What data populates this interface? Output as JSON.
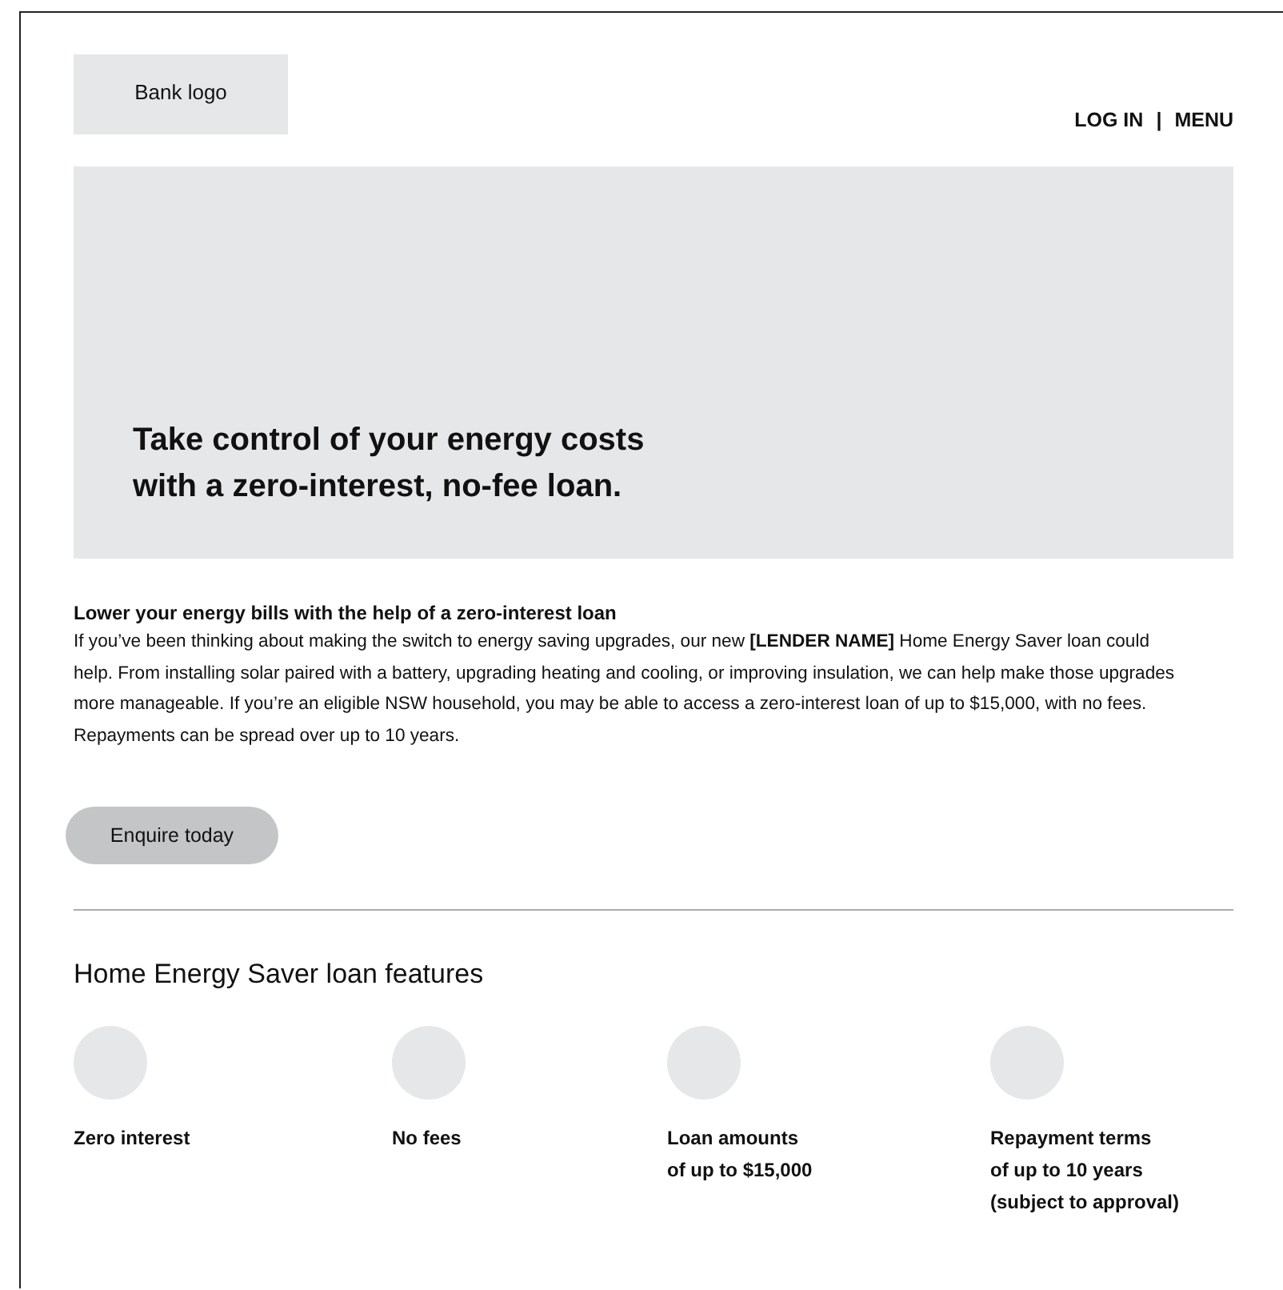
{
  "header": {
    "logo": "Bank logo",
    "nav": {
      "log_in": "LOG IN",
      "separator": "|",
      "menu": "MENU"
    }
  },
  "hero": {
    "title_lines": [
      "Take control of your energy costs",
      "with a zero-interest, no-fee loan."
    ]
  },
  "intro": {
    "heading": "Lower your energy bills with the help of a zero-interest loan",
    "body": "If you’ve been thinking about making the switch to energy saving upgrades, our new **[LENDER NAME]** Home Energy Saver loan could help. From installing solar paired with a battery, upgrading heating and cooling, or improving insulation, we can help make those upgrades more manageable. If you’re an eligible NSW household, you may be able to access a zero-interest loan of up to $15,000, with no fees. Repayments can be spread over up to 10 years.",
    "button": "Enquire today"
  },
  "features": {
    "heading": "Home Energy Saver loan features",
    "items": [
      {
        "lines": [
          "Zero interest"
        ]
      },
      {
        "lines": [
          "No fees"
        ]
      },
      {
        "lines": [
          "Loan amounts",
          "of up to $15,000"
        ]
      },
      {
        "lines": [
          "Repayment terms",
          "of up to 10 years",
          "(subject to approval)"
        ]
      }
    ]
  }
}
